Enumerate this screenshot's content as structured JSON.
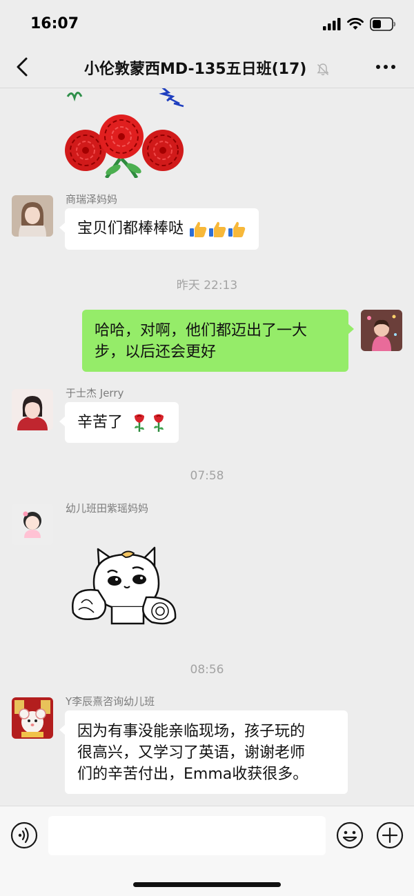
{
  "status_bar": {
    "time": "16:07"
  },
  "header": {
    "title": "小伦敦蒙西MD-135五日班(17)"
  },
  "messages": [
    {
      "type": "image",
      "side": "left",
      "content": "sticker-flowers"
    },
    {
      "type": "text",
      "side": "left",
      "sender": "商瑞泽妈妈",
      "text": "宝贝们都棒棒哒",
      "emoji": [
        "thumbs-up-icon",
        "thumbs-up-icon",
        "thumbs-up-icon"
      ]
    },
    {
      "type": "timestamp",
      "text": "昨天 22:13"
    },
    {
      "type": "text",
      "side": "right",
      "text": "哈哈，对啊，他们都迈出了一大步，以后还会更好"
    },
    {
      "type": "text",
      "side": "left",
      "sender": "于士杰 Jerry",
      "text": "辛苦了",
      "emoji": [
        "rose-icon",
        "rose-icon"
      ]
    },
    {
      "type": "timestamp",
      "text": "07:58"
    },
    {
      "type": "sticker",
      "side": "left",
      "sender": "幼儿班田紫瑶妈妈",
      "content": "cat-sticker"
    },
    {
      "type": "timestamp",
      "text": "08:56"
    },
    {
      "type": "text",
      "side": "left",
      "sender": "Y李辰熹咨询幼儿班",
      "text": "因为有事没能亲临现场，孩子玩的很高兴，又学习了英语，谢谢老师们的辛苦付出，Emma收获很多。"
    }
  ],
  "ui": {
    "msg2_line1": "哈哈，对啊，他们都迈出了一大",
    "msg2_line2": "步，以后还会更好",
    "msg4_line1": "因为有事没能亲临现场，孩子玩的",
    "msg4_line2": "很高兴，又学习了英语，谢谢老师",
    "msg4_line3": "们的辛苦付出，Emma收获很多。"
  },
  "input_bar": {
    "placeholder": ""
  },
  "colors": {
    "background": "#ededed",
    "bubble_sent": "#95ec69",
    "bubble_received": "#ffffff",
    "accent": "#07c160"
  }
}
